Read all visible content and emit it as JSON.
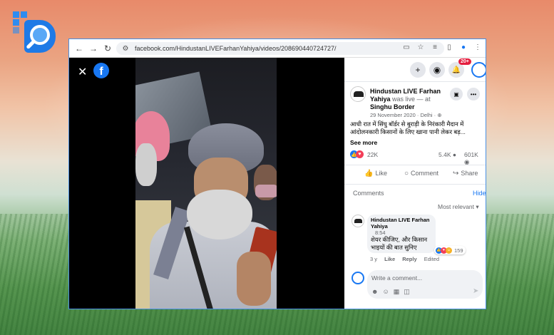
{
  "browser": {
    "url": "facebook.com/HindustanLIVEFarhanYahiya/videos/208690440724727/",
    "nav": {
      "back": "←",
      "forward": "→",
      "reload": "↻"
    }
  },
  "video": {
    "close_glyph": "✕",
    "fb_logo_glyph": "f"
  },
  "topbar": {
    "add_glyph": "+",
    "messenger_glyph": "◉",
    "bell_glyph": "🔔",
    "notification_badge": "20+"
  },
  "post": {
    "page_name": "Hindustan LIVE Farhan Yahiya",
    "was_live": "was live — at",
    "location": "Singhu Border",
    "date": "29 November 2020 · Delhi ·",
    "text": "आधी रात में सिंघु बॉर्डर से बुराड़ी के निरंकारी मैदान में आंदोलनकारी किसानों के लिए खाना पानी लेकर बड़...",
    "see_more": "See more",
    "reactions": "22K",
    "comments_count": "5.4K",
    "views": "601K"
  },
  "actions": {
    "like": "Like",
    "comment": "Comment",
    "share": "Share"
  },
  "comments": {
    "header": "Comments",
    "hide": "Hide",
    "sort": "Most relevant",
    "items": [
      {
        "author": "Hindustan LIVE Farhan Yahiya",
        "timestamp": "8:54",
        "text": "शेयर कीजिए, और किसान भाइयों की बात सुनिए",
        "reaction_count": "159",
        "age": "3 y",
        "like": "Like",
        "reply": "Reply",
        "edited": "Edited"
      }
    ],
    "write_placeholder": "Write a comment..."
  },
  "colors": {
    "facebook_blue": "#1877f2",
    "window_border": "#4a90e2"
  }
}
